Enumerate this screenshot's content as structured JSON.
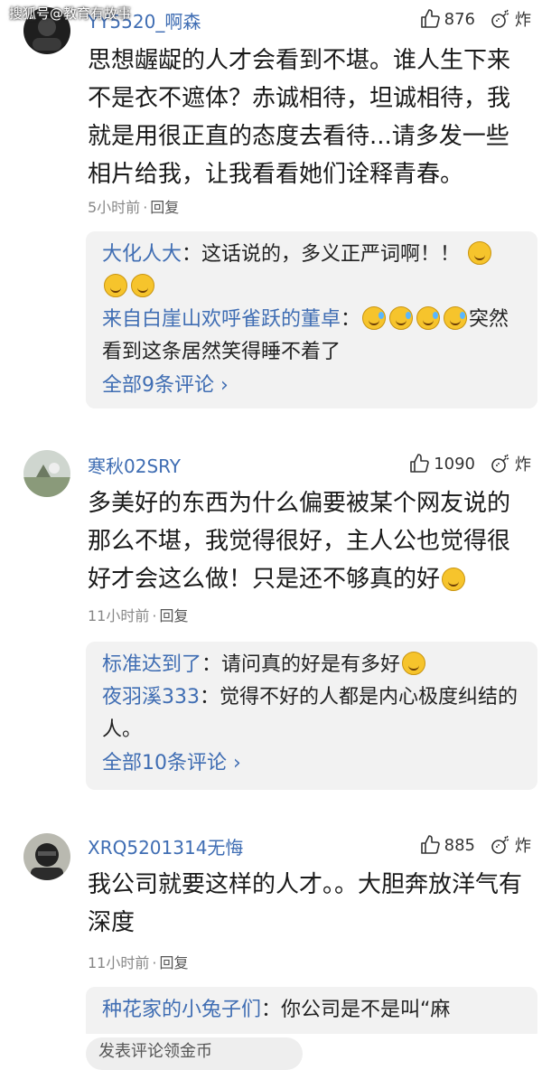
{
  "watermark": "搜狐号@教育有故事",
  "comments": [
    {
      "username": "YY5520_啊森",
      "likes": "876",
      "dislike_label": "炸",
      "text": "思想龌龊的人才会看到不堪。谁人生下来不是衣不遮体？赤诚相待，坦诚相待，我就是用很正直的态度去看待...请多发一些相片给我，让我看看她们诠释青春。",
      "time": "5小时前",
      "reply_label": "回复",
      "replies": [
        {
          "user": "大化人大",
          "text": "这话说的，多义正严词啊！！"
        },
        {
          "user": "来自白崖山欢呼雀跃的董卓",
          "text": "突然看到这条居然笑得睡不着了"
        }
      ],
      "all_link": "全部9条评论"
    },
    {
      "username": "寒秋02SRY",
      "likes": "1090",
      "dislike_label": "炸",
      "text": "多美好的东西为什么偏要被某个网友说的那么不堪，我觉得很好，主人公也觉得很好才会这么做！只是还不够真的好",
      "time": "11小时前",
      "reply_label": "回复",
      "replies": [
        {
          "user": "标准达到了",
          "text": "请问真的好是有多好"
        },
        {
          "user": "夜羽溪333",
          "text": "觉得不好的人都是内心极度纠结的人。"
        }
      ],
      "all_link": "全部10条评论"
    },
    {
      "username": "XRQ5201314无悔",
      "likes": "885",
      "dislike_label": "炸",
      "text": "我公司就要这样的人才。。大胆奔放洋气有深度",
      "time": "11小时前",
      "reply_label": "回复",
      "replies": [
        {
          "user": "种花家的小兔子们",
          "text": "你公司是不是叫“麻"
        }
      ]
    }
  ],
  "input_placeholder": "发表评论领金币"
}
